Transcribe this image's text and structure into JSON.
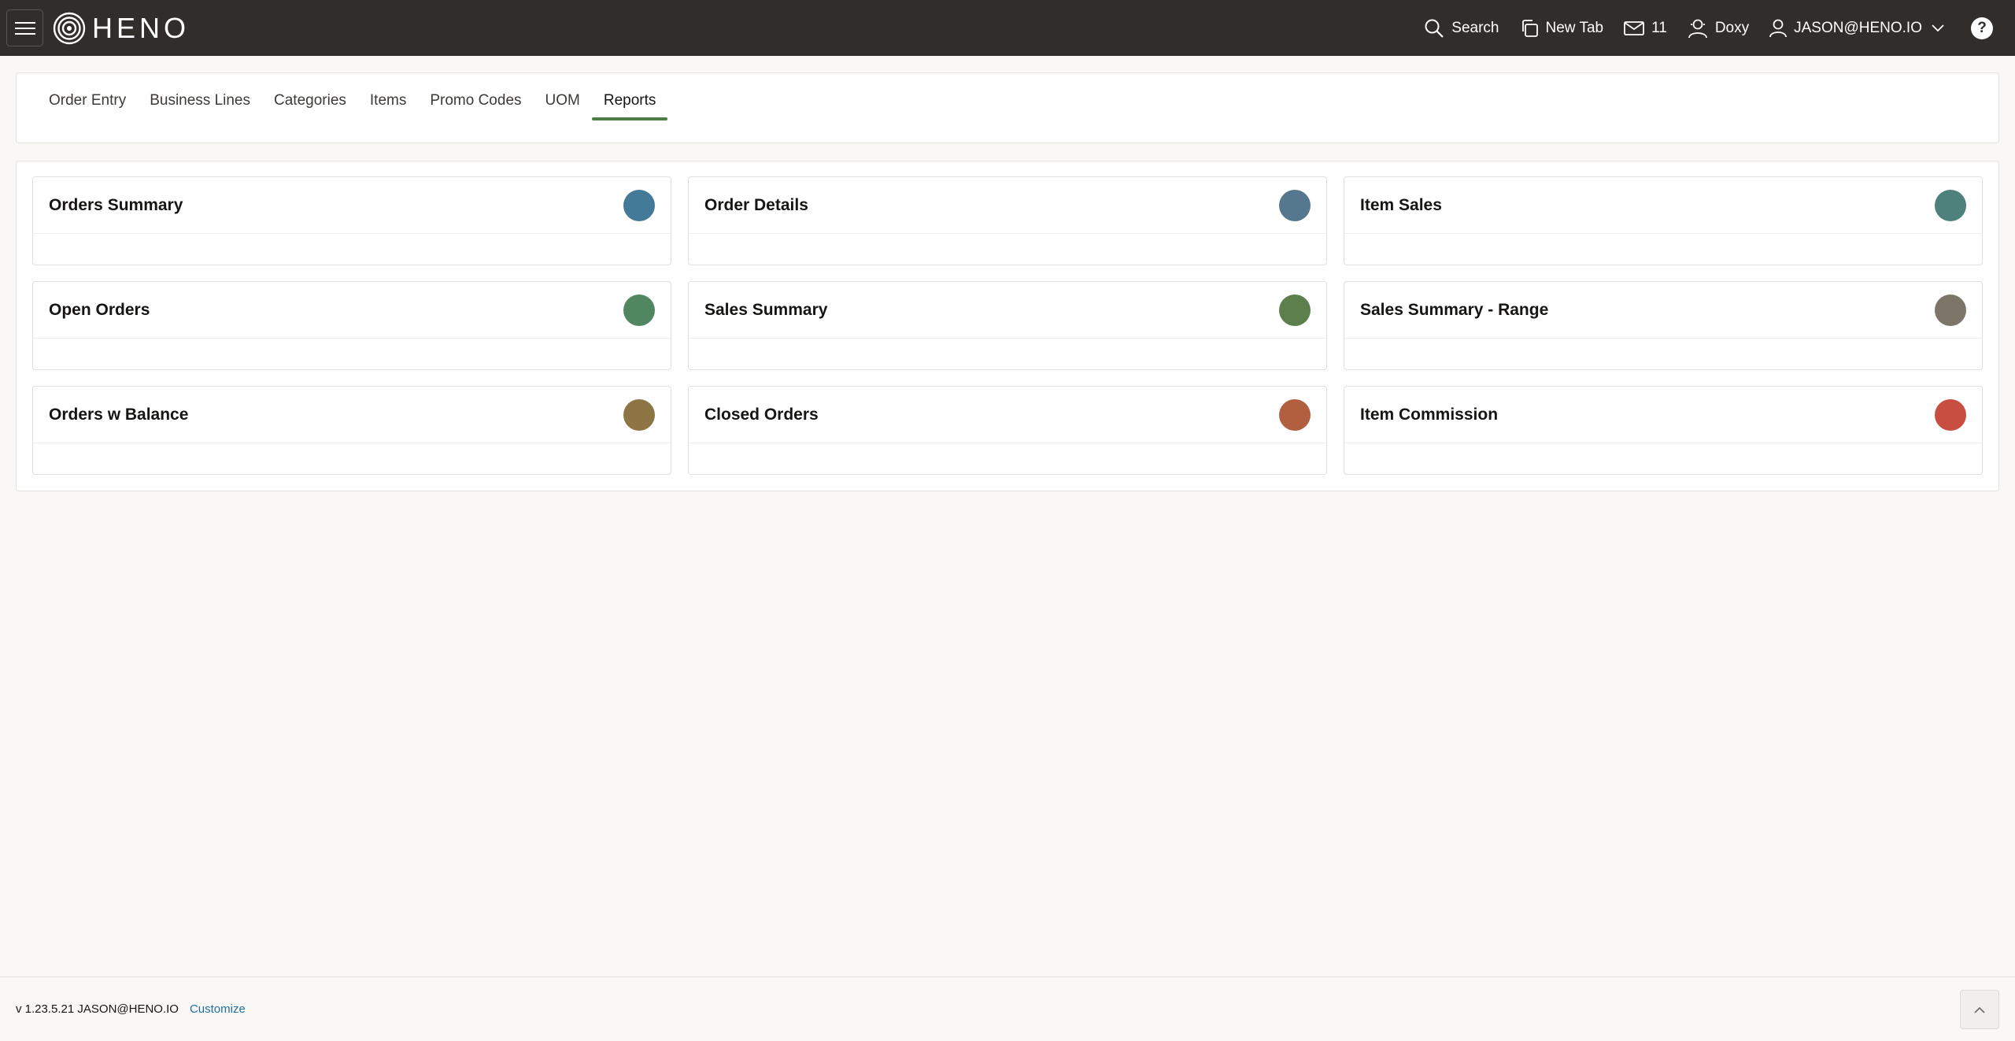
{
  "header": {
    "logo_text": "HENO",
    "search_label": "Search",
    "new_tab_label": "New Tab",
    "mail_count": "11",
    "doxy_label": "Doxy",
    "user_label": "JASON@HENO.IO",
    "help_glyph": "?"
  },
  "tabs": [
    {
      "label": "Order Entry",
      "active": false
    },
    {
      "label": "Business Lines",
      "active": false
    },
    {
      "label": "Categories",
      "active": false
    },
    {
      "label": "Items",
      "active": false
    },
    {
      "label": "Promo Codes",
      "active": false
    },
    {
      "label": "UOM",
      "active": false
    },
    {
      "label": "Reports",
      "active": true
    }
  ],
  "reports": [
    {
      "title": "Orders Summary",
      "color": "#437a97"
    },
    {
      "title": "Order Details",
      "color": "#56788e"
    },
    {
      "title": "Item Sales",
      "color": "#4e807c"
    },
    {
      "title": "Open Orders",
      "color": "#508660"
    },
    {
      "title": "Sales Summary",
      "color": "#5c7f4c"
    },
    {
      "title": "Sales Summary - Range",
      "color": "#7c7568"
    },
    {
      "title": "Orders w Balance",
      "color": "#8d7544"
    },
    {
      "title": "Closed Orders",
      "color": "#b0603f"
    },
    {
      "title": "Item Commission",
      "color": "#c74e41"
    }
  ],
  "footer": {
    "version": "v 1.23.5.21 JASON@HENO.IO",
    "customize_label": "Customize"
  }
}
